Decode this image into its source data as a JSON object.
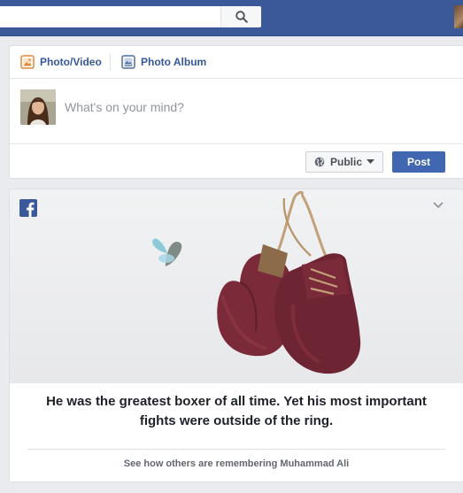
{
  "search": {
    "value": "",
    "placeholder": ""
  },
  "composer": {
    "tabs": [
      {
        "label": "Photo/Video",
        "icon": "photo-icon"
      },
      {
        "label": "Photo Album",
        "icon": "album-icon"
      }
    ],
    "placeholder": "What's on your mind?",
    "privacy_label": "Public",
    "post_label": "Post"
  },
  "feature": {
    "headline": "He was the greatest boxer of all time. Yet his most important fights were outside of the ring.",
    "link_text": "See how others are remembering Muhammad Ali"
  },
  "colors": {
    "brand": "#3b5998",
    "button": "#4267b2",
    "link": "#365899",
    "glove": "#7a2a38"
  }
}
